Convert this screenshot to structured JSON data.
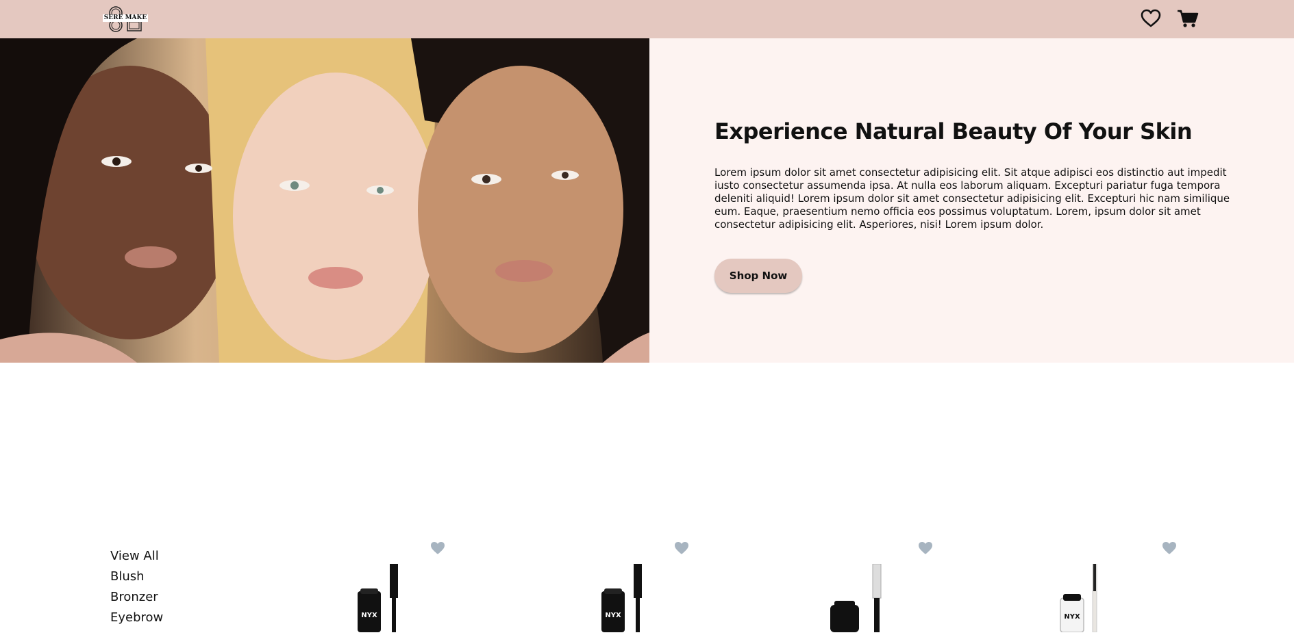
{
  "brand": {
    "logo_text": "SERE MAKE",
    "logo_icon": "logo-icon"
  },
  "header": {
    "icons": {
      "wishlist": "heart-icon",
      "cart": "cart-icon"
    },
    "background": "#e4c8c0"
  },
  "hero": {
    "title": "Experience Natural Beauty Of Your Skin",
    "body": "Lorem ipsum dolor sit amet consectetur adipisicing elit. Sit atque adipisci eos distinctio aut impedit iusto consectetur assumenda ipsa. At nulla eos laborum aliquam. Excepturi pariatur fuga tempora deleniti aliquid! Lorem ipsum dolor sit amet consectetur adipisicing elit. Excepturi hic nam similique eum. Eaque, praesentium nemo officia eos possimus voluptatum. Lorem, ipsum dolor sit amet consectetur adipisicing elit. Asperiores, nisi! Lorem ipsum dolor.",
    "cta_label": "Shop Now",
    "panel_color": "#fdf3f1",
    "button_color": "#e4c8c0"
  },
  "categories": [
    {
      "label": "View All"
    },
    {
      "label": "Blush"
    },
    {
      "label": "Bronzer"
    },
    {
      "label": "Eyebrow"
    }
  ],
  "products": [
    {
      "brand_mark": "NYX",
      "fav_icon": "heart-icon",
      "variant": "black"
    },
    {
      "brand_mark": "NYX",
      "fav_icon": "heart-icon",
      "variant": "black"
    },
    {
      "brand_mark": "",
      "fav_icon": "heart-icon",
      "variant": "black-white-brush"
    },
    {
      "brand_mark": "NYX",
      "fav_icon": "heart-icon",
      "variant": "clear"
    }
  ],
  "colors": {
    "fav_heart": "#a7b4c0"
  }
}
